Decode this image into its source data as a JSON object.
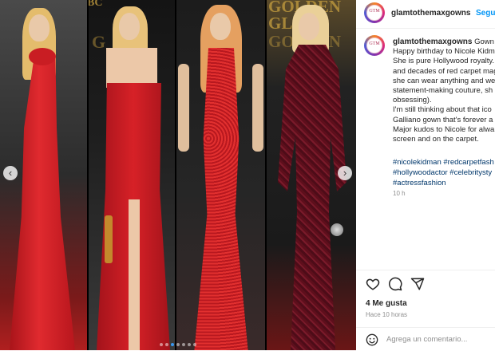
{
  "header": {
    "username": "glamtothemaxgowns",
    "follow_label": "Segui"
  },
  "caption": {
    "username": "glamtothemaxgowns",
    "lines": [
      "Gown St",
      "Happy birthday to Nicole Kidm",
      "She is pure Hollywood royalty.",
      "and decades of red carpet mag",
      "she can wear anything and we",
      "statement-making couture, sh",
      "obsessing).",
      "I'm still thinking about that ico",
      "Galliano gown that's forever a",
      "Major kudos to Nicole for alwa",
      "screen and on the carpet."
    ],
    "tags": [
      "#nicolekidman #redcarpetfash",
      "#hollywoodactor #celebritysty",
      "#actressfashion"
    ],
    "time": "10 h"
  },
  "likes": "4 Me gusta",
  "ago": "Hace 10 horas",
  "comment": {
    "placeholder": "Agrega un comentario..."
  },
  "media": {
    "bg_text": [
      "BC",
      "GOLDEN",
      "GLOBE",
      "GOLDEN"
    ],
    "accent": "#3897f0",
    "gown_colors": [
      "#d81f26",
      "#cf1c24",
      "#d42a2a",
      "#5e0f1c"
    ]
  },
  "icons": [
    "heart-icon",
    "comment-icon",
    "share-icon",
    "emoji-icon",
    "chevron-left-icon",
    "chevron-right-icon"
  ]
}
